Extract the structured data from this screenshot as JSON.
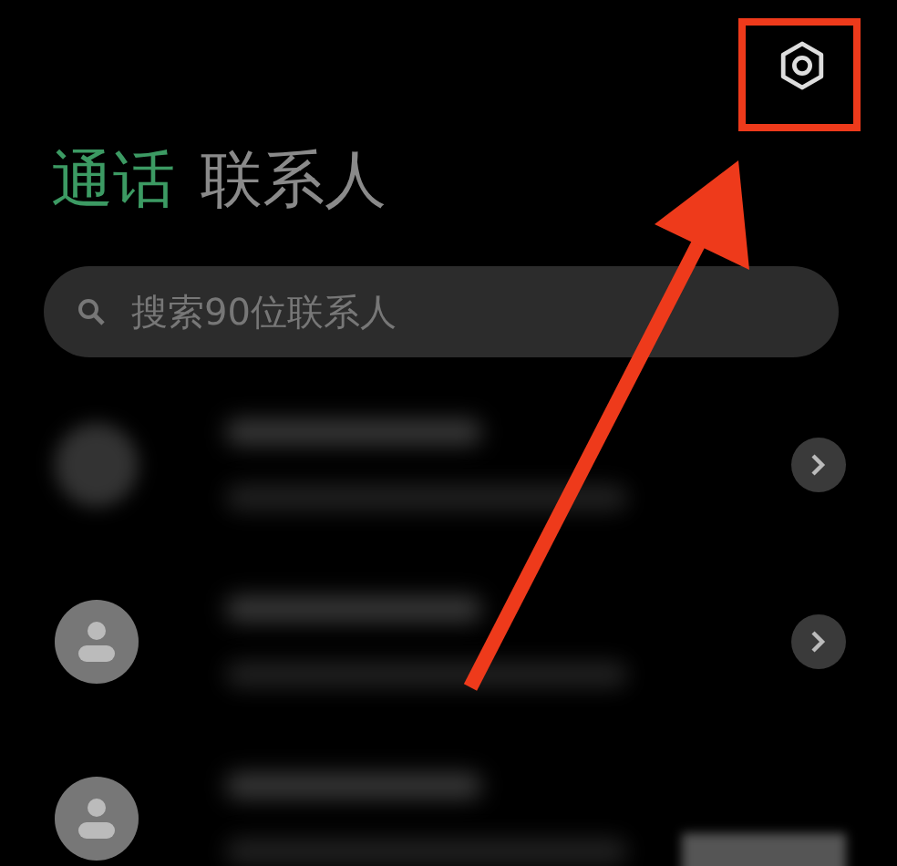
{
  "tabs": [
    {
      "label": "通话",
      "selected": true
    },
    {
      "label": "联系人",
      "selected": false
    }
  ],
  "search": {
    "placeholder": "搜索90位联系人"
  },
  "contacts": [
    {
      "kind": "blurred",
      "chevron": true
    },
    {
      "kind": "person",
      "chevron": true
    },
    {
      "kind": "person",
      "chevron": false
    }
  ],
  "annotation": {
    "highlight_box": true,
    "arrow": true
  }
}
